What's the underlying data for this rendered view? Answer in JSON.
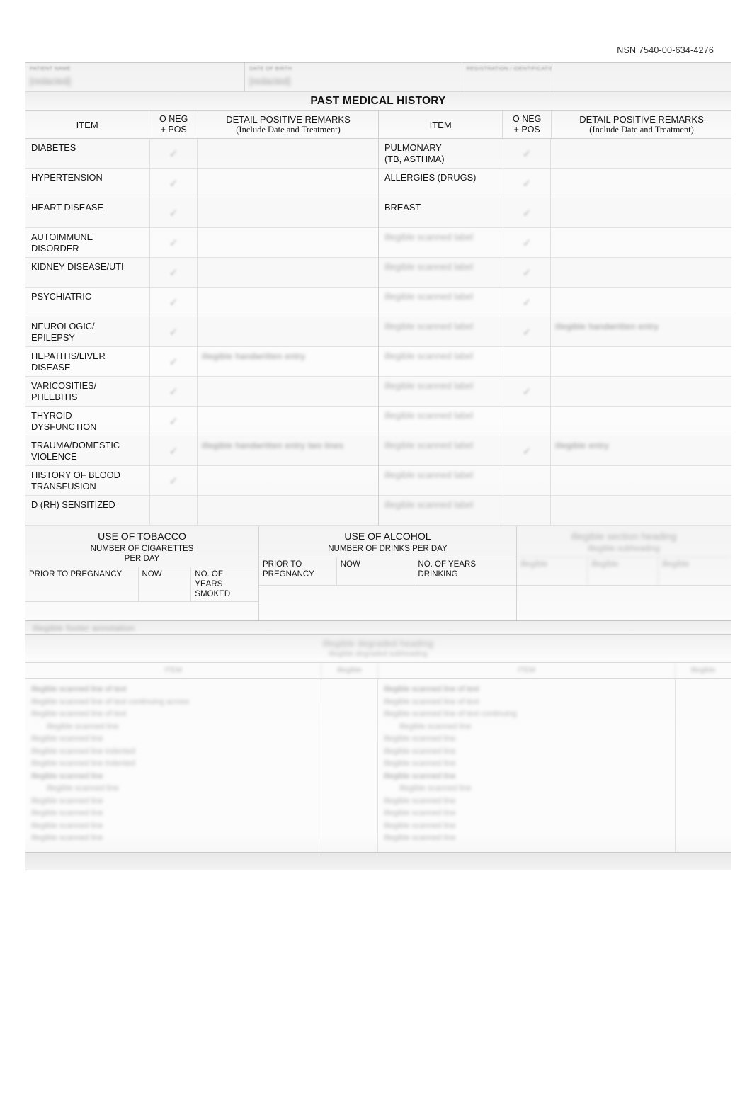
{
  "document": {
    "nsn": "NSN 7540-00-634-4276",
    "section_title": "PAST MEDICAL HISTORY"
  },
  "patient_header": {
    "fields": [
      {
        "label": "PATIENT NAME",
        "value": "[redacted]"
      },
      {
        "label": "DATE OF BIRTH",
        "value": "[redacted]"
      },
      {
        "label": "REGISTRATION / IDENTIFICATION",
        "value": ""
      },
      {
        "label": "",
        "value": ""
      }
    ]
  },
  "column_headers": {
    "item": "ITEM",
    "oneg_line1": "O NEG",
    "oneg_line2": "+ POS",
    "detail_line1": "DETAIL POSITIVE REMARKS",
    "detail_line2": "(Include Date and Treatment)"
  },
  "left_rows": [
    {
      "item": "DIABETES",
      "mark": "✓",
      "remark": ""
    },
    {
      "item": "HYPERTENSION",
      "mark": "✓",
      "remark": ""
    },
    {
      "item": "HEART DISEASE",
      "mark": "✓",
      "remark": ""
    },
    {
      "item": "AUTOIMMUNE\nDISORDER",
      "mark": "✓",
      "remark": ""
    },
    {
      "item": "KIDNEY DISEASE/UTI",
      "mark": "✓",
      "remark": ""
    },
    {
      "item": "PSYCHIATRIC",
      "mark": "✓",
      "remark": ""
    },
    {
      "item": "NEUROLOGIC/\nEPILEPSY",
      "mark": "✓",
      "remark": ""
    },
    {
      "item": "HEPATITIS/LIVER\nDISEASE",
      "mark": "✓",
      "remark": "illegible handwritten entry"
    },
    {
      "item": "VARICOSITIES/\nPHLEBITIS",
      "mark": "✓",
      "remark": ""
    },
    {
      "item": "THYROID\nDYSFUNCTION",
      "mark": "✓",
      "remark": ""
    },
    {
      "item": "TRAUMA/DOMESTIC\nVIOLENCE",
      "mark": "✓",
      "remark": "illegible handwritten entry two lines"
    },
    {
      "item": "HISTORY OF BLOOD\nTRANSFUSION",
      "mark": "✓",
      "remark": ""
    },
    {
      "item": "D (RH) SENSITIZED",
      "mark": "",
      "remark": ""
    }
  ],
  "right_rows": [
    {
      "item": "PULMONARY\n(TB, ASTHMA)",
      "mark": "✓",
      "remark": "",
      "legible": true
    },
    {
      "item": "ALLERGIES (DRUGS)",
      "mark": "✓",
      "remark": "",
      "legible": true
    },
    {
      "item": "BREAST",
      "mark": "✓",
      "remark": "",
      "legible": true
    },
    {
      "item": "illegible scanned label",
      "mark": "✓",
      "remark": "",
      "legible": false
    },
    {
      "item": "illegible scanned label",
      "mark": "✓",
      "remark": "",
      "legible": false
    },
    {
      "item": "illegible scanned label",
      "mark": "✓",
      "remark": "",
      "legible": false
    },
    {
      "item": "illegible scanned label",
      "mark": "✓",
      "remark": "illegible handwritten entry",
      "legible": false
    },
    {
      "item": "illegible scanned label",
      "mark": "",
      "remark": "",
      "legible": false
    },
    {
      "item": "illegible scanned label",
      "mark": "✓",
      "remark": "",
      "legible": false
    },
    {
      "item": "illegible scanned label",
      "mark": "",
      "remark": "",
      "legible": false
    },
    {
      "item": "illegible scanned label",
      "mark": "✓",
      "remark": "illegible entry",
      "legible": false
    },
    {
      "item": "illegible scanned label",
      "mark": "",
      "remark": "",
      "legible": false
    },
    {
      "item": "illegible scanned label",
      "mark": "",
      "remark": "",
      "legible": false
    }
  ],
  "habits": {
    "tobacco": {
      "title": "USE OF TOBACCO",
      "subtitle": "NUMBER OF CIGARETTES\nPER DAY",
      "cells": [
        {
          "label": "PRIOR TO PREGNANCY",
          "value": ""
        },
        {
          "label": "NOW",
          "value": ""
        },
        {
          "label": "NO. OF\nYEARS\nSMOKED",
          "value": ""
        }
      ]
    },
    "alcohol": {
      "title": "USE OF ALCOHOL",
      "subtitle": "NUMBER OF DRINKS PER DAY",
      "cells": [
        {
          "label": "PRIOR TO\nPREGNANCY",
          "value": ""
        },
        {
          "label": "NOW",
          "value": ""
        },
        {
          "label": "NO. OF YEARS\nDRINKING",
          "value": ""
        }
      ]
    },
    "third": {
      "title": "illegible section heading",
      "subtitle": "illegible subheading",
      "cells": [
        {
          "label": "illegible",
          "value": ""
        },
        {
          "label": "illegible",
          "value": ""
        },
        {
          "label": "illegible",
          "value": ""
        }
      ]
    },
    "footer_note": "illegible footer annotation"
  },
  "lower_table": {
    "title": "illegible degraded heading",
    "subtitle": "illegible degraded subheading",
    "headers": [
      "ITEM",
      "illegible",
      "ITEM",
      "illegible"
    ],
    "left_lines": [
      "illegible scanned line of text",
      "illegible scanned line of text continuing across",
      "illegible scanned line of text",
      "illegible scanned line",
      "illegible scanned line",
      "illegible scanned line indented",
      "illegible scanned line indented",
      "illegible scanned line",
      "illegible scanned line",
      "illegible scanned line",
      "illegible scanned line",
      "illegible scanned line",
      "illegible scanned line"
    ],
    "right_lines": [
      "illegible scanned line of text",
      "illegible scanned line of text",
      "illegible scanned line of text continuing",
      "illegible scanned line",
      "illegible scanned line",
      "illegible scanned line",
      "illegible scanned line",
      "illegible scanned line",
      "illegible scanned line",
      "illegible scanned line",
      "illegible scanned line",
      "illegible scanned line",
      "illegible scanned line"
    ]
  }
}
